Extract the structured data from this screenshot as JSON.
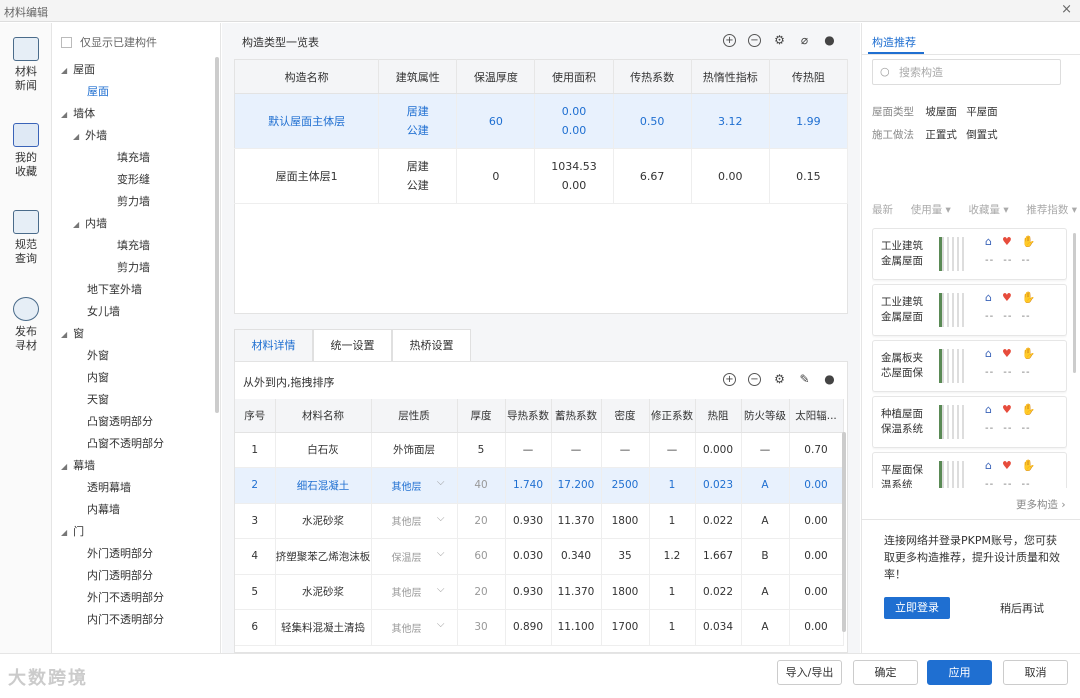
{
  "window": {
    "title": "材料编辑",
    "close": "×"
  },
  "rail": [
    {
      "label": "材料\n新闻",
      "icon": "material-news-icon"
    },
    {
      "label": "我的\n收藏",
      "icon": "favorites-icon"
    },
    {
      "label": "规范\n查询",
      "icon": "standard-query-icon"
    },
    {
      "label": "发布\n寻材",
      "icon": "publish-search-icon"
    }
  ],
  "tree": {
    "filter_label": "仅显示已建构件",
    "nodes": [
      {
        "label": "屋面",
        "level": 0,
        "tri": "◢"
      },
      {
        "label": "屋面",
        "level": 1,
        "selected": true
      },
      {
        "label": "墙体",
        "level": 0,
        "tri": "◢"
      },
      {
        "label": "外墙",
        "level": 1,
        "tri": "◢"
      },
      {
        "label": "填充墙",
        "level": 2
      },
      {
        "label": "变形缝",
        "level": 2
      },
      {
        "label": "剪力墙",
        "level": 2
      },
      {
        "label": "内墙",
        "level": 1,
        "tri": "◢"
      },
      {
        "label": "填充墙",
        "level": 2
      },
      {
        "label": "剪力墙",
        "level": 2
      },
      {
        "label": "地下室外墙",
        "level": 1
      },
      {
        "label": "女儿墙",
        "level": 1
      },
      {
        "label": "窗",
        "level": 0,
        "tri": "◢"
      },
      {
        "label": "外窗",
        "level": 1
      },
      {
        "label": "内窗",
        "level": 1
      },
      {
        "label": "天窗",
        "level": 1
      },
      {
        "label": "凸窗透明部分",
        "level": 1
      },
      {
        "label": "凸窗不透明部分",
        "level": 1
      },
      {
        "label": "幕墙",
        "level": 0,
        "tri": "◢"
      },
      {
        "label": "透明幕墙",
        "level": 1
      },
      {
        "label": "内幕墙",
        "level": 1
      },
      {
        "label": "门",
        "level": 0,
        "tri": "◢"
      },
      {
        "label": "外门透明部分",
        "level": 1
      },
      {
        "label": "内门透明部分",
        "level": 1
      },
      {
        "label": "外门不透明部分",
        "level": 1
      },
      {
        "label": "内门不透明部分",
        "level": 1
      }
    ]
  },
  "types": {
    "title": "构造类型一览表",
    "columns": [
      "构造名称",
      "建筑属性",
      "保温厚度",
      "使用面积",
      "传热系数",
      "热惰性指标",
      "传热阻"
    ],
    "rows": [
      {
        "cells": [
          "默认屋面主体层",
          "居建\n公建",
          "60",
          "0.00\n0.00",
          "0.50",
          "3.12",
          "1.99"
        ],
        "selected": true
      },
      {
        "cells": [
          "屋面主体层1",
          "居建\n公建",
          "0",
          "1034.53\n0.00",
          "6.67",
          "0.00",
          "0.15"
        ],
        "selected": false
      }
    ]
  },
  "tabs": [
    "材料详情",
    "统一设置",
    "热桥设置"
  ],
  "detail": {
    "title": "从外到内,拖拽排序",
    "columns": [
      "序号",
      "材料名称",
      "层性质",
      "厚度",
      "导热系数",
      "蓄热系数",
      "密度",
      "修正系数",
      "热阻",
      "防火等级",
      "太阳辐..."
    ],
    "rows": [
      {
        "cells": [
          "1",
          "白石灰",
          "外饰面层",
          "5",
          "—",
          "—",
          "—",
          "—",
          "0.000",
          "—",
          "0.70"
        ],
        "dd": false,
        "selected": false
      },
      {
        "cells": [
          "2",
          "细石混凝土",
          "其他层",
          "40",
          "1.740",
          "17.200",
          "2500",
          "1",
          "0.023",
          "A",
          "0.00"
        ],
        "dd": true,
        "selected": true
      },
      {
        "cells": [
          "3",
          "水泥砂浆",
          "其他层",
          "20",
          "0.930",
          "11.370",
          "1800",
          "1",
          "0.022",
          "A",
          "0.00"
        ],
        "dd": true,
        "selected": false
      },
      {
        "cells": [
          "4",
          "挤塑聚苯乙烯泡沫板",
          "保温层",
          "60",
          "0.030",
          "0.340",
          "35",
          "1.2",
          "1.667",
          "B",
          "0.00"
        ],
        "dd": true,
        "selected": false
      },
      {
        "cells": [
          "5",
          "水泥砂浆",
          "其他层",
          "20",
          "0.930",
          "11.370",
          "1800",
          "1",
          "0.022",
          "A",
          "0.00"
        ],
        "dd": true,
        "selected": false
      },
      {
        "cells": [
          "6",
          "轻集料混凝土清捣",
          "其他层",
          "30",
          "0.890",
          "11.100",
          "1700",
          "1",
          "0.034",
          "A",
          "0.00"
        ],
        "dd": true,
        "selected": false
      }
    ]
  },
  "right": {
    "tab": "构造推荐",
    "search_placeholder": "搜索构造",
    "roof_type_label": "屋面类型",
    "roof_types": [
      "坡屋面",
      "平屋面"
    ],
    "method_label": "施工做法",
    "methods": [
      "正置式",
      "倒置式"
    ],
    "sort": [
      "最新",
      "使用量 ▾",
      "收藏量 ▾",
      "推荐指数 ▾"
    ],
    "cards": [
      {
        "name": "工业建筑\n金属屋面",
        "stats": [
          "--",
          "--",
          "--"
        ]
      },
      {
        "name": "工业建筑\n金属屋面",
        "stats": [
          "--",
          "--",
          "--"
        ]
      },
      {
        "name": "金属板夹\n芯屋面保",
        "stats": [
          "--",
          "--",
          "--"
        ]
      },
      {
        "name": "种植屋面\n保温系统",
        "stats": [
          "--",
          "--",
          "--"
        ]
      },
      {
        "name": "平屋面保\n温系统",
        "stats": [
          "--",
          "--",
          "--"
        ]
      }
    ],
    "more": "更多构造 ›",
    "login_text": "连接网络并登录PKPM账号，您可获取更多构造推荐，提升设计质量和效率！",
    "login_button": "立即登录",
    "later_button": "稍后再试"
  },
  "footer": {
    "watermark": "大数跨境",
    "import_export": "导入/导出",
    "ok": "确定",
    "apply": "应用",
    "cancel": "取消"
  }
}
